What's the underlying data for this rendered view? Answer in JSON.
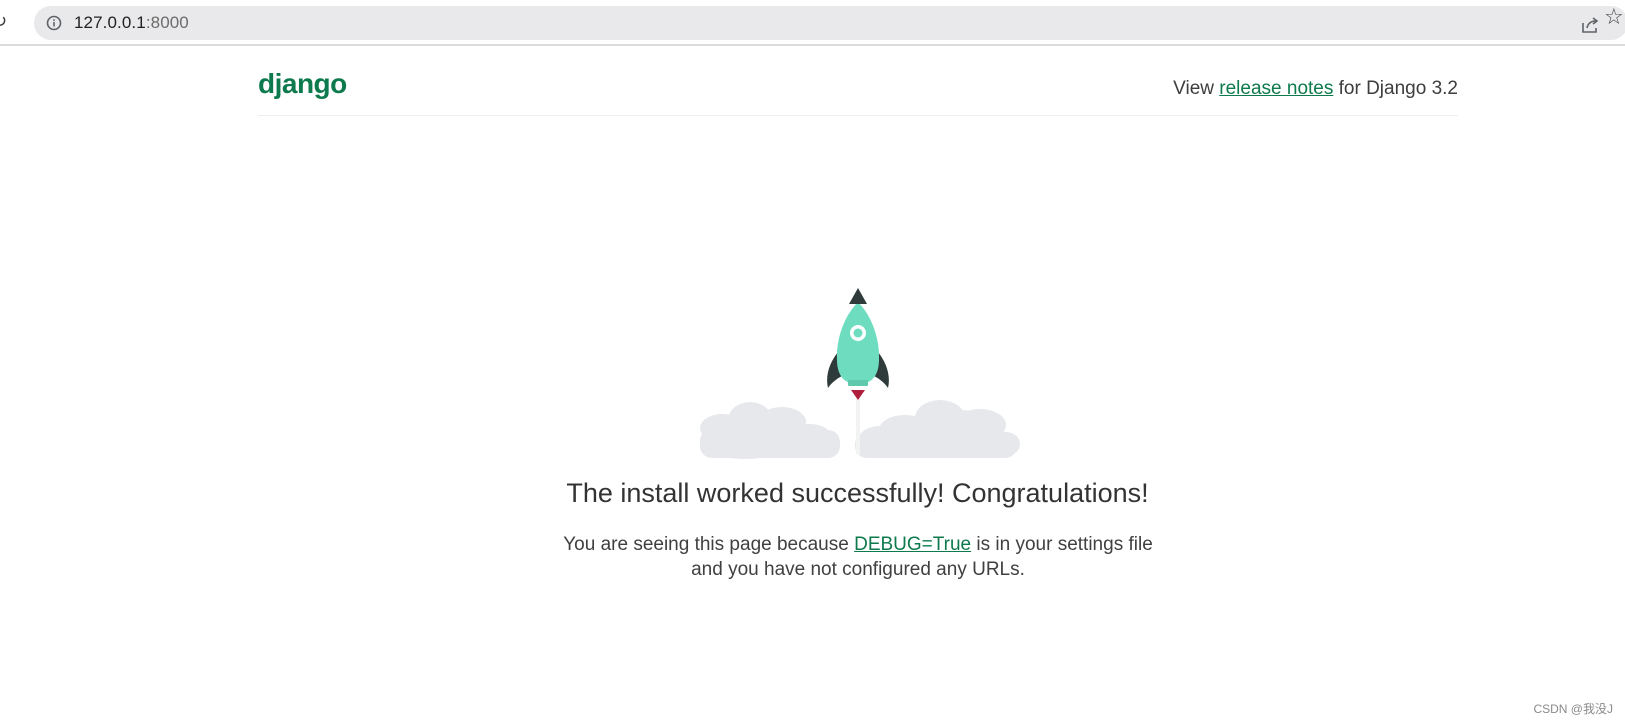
{
  "browser": {
    "url_host": "127.0.0.1",
    "url_port": ":8000",
    "icons": {
      "reload": "reload-icon",
      "info": "info-icon",
      "share": "share-icon",
      "bookmark": "star-icon"
    }
  },
  "header": {
    "logo_text": "django",
    "release_prefix": "View ",
    "release_link": "release notes",
    "release_suffix": " for Django 3.2"
  },
  "main": {
    "headline": "The install worked successfully! Congratulations!",
    "desc_prefix": "You are seeing this page because ",
    "desc_link": "DEBUG=True",
    "desc_suffix": " is in your settings file and you have not configured any URLs."
  },
  "watermark": "CSDN @我没J",
  "colors": {
    "brand_green": "#0c7a4c",
    "rocket_body": "#6ddcbf",
    "rocket_dark": "#2f3a3a",
    "flame": "#b01e3e",
    "cloud": "#e6e8ec"
  }
}
